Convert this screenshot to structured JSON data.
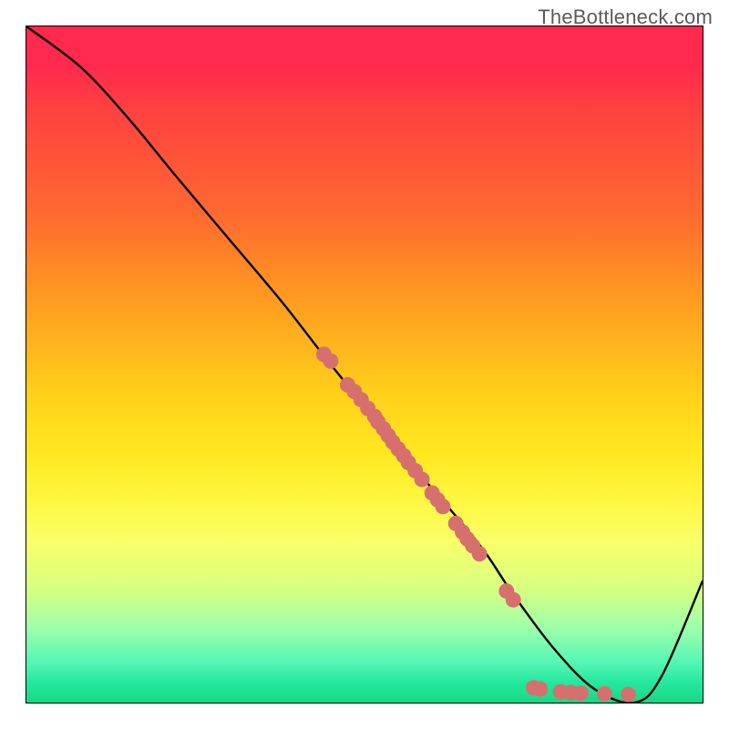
{
  "watermark": "TheBottleneck.com",
  "chart_data": {
    "type": "line",
    "title": "",
    "xlabel": "",
    "ylabel": "",
    "xlim": [
      0,
      100
    ],
    "ylim": [
      0,
      100
    ],
    "grid": false,
    "legend": false,
    "series": [
      {
        "name": "bottleneck_curve",
        "x": [
          0,
          8,
          15,
          22,
          30,
          38,
          45,
          52,
          58,
          64,
          68,
          72,
          78,
          84,
          90,
          94,
          100
        ],
        "y": [
          100,
          94,
          86.5,
          78,
          68.5,
          59,
          50,
          41.5,
          34,
          27,
          22,
          16,
          8,
          2,
          0,
          4,
          18
        ]
      }
    ],
    "scatter": {
      "name": "highlighted_points",
      "color": "#d6706e",
      "points": [
        {
          "x": 44,
          "y": 51.5
        },
        {
          "x": 45,
          "y": 50.5
        },
        {
          "x": 47.5,
          "y": 47
        },
        {
          "x": 48.5,
          "y": 46
        },
        {
          "x": 49.5,
          "y": 44.8
        },
        {
          "x": 50.5,
          "y": 43.5
        },
        {
          "x": 51.5,
          "y": 42.3
        },
        {
          "x": 52,
          "y": 41.5
        },
        {
          "x": 52.8,
          "y": 40.5
        },
        {
          "x": 53.5,
          "y": 39.5
        },
        {
          "x": 54.2,
          "y": 38.5
        },
        {
          "x": 55,
          "y": 37.5
        },
        {
          "x": 55.8,
          "y": 36.5
        },
        {
          "x": 56.5,
          "y": 35.5
        },
        {
          "x": 57.5,
          "y": 34.3
        },
        {
          "x": 58.5,
          "y": 33
        },
        {
          "x": 60,
          "y": 31
        },
        {
          "x": 60.8,
          "y": 30
        },
        {
          "x": 61.6,
          "y": 29
        },
        {
          "x": 63.5,
          "y": 26.5
        },
        {
          "x": 64.5,
          "y": 25.2
        },
        {
          "x": 65.2,
          "y": 24.2
        },
        {
          "x": 66,
          "y": 23.2
        },
        {
          "x": 67,
          "y": 22
        },
        {
          "x": 71,
          "y": 16.5
        },
        {
          "x": 72,
          "y": 15.2
        },
        {
          "x": 75,
          "y": 2.2
        },
        {
          "x": 76,
          "y": 2
        },
        {
          "x": 79,
          "y": 1.6
        },
        {
          "x": 80.5,
          "y": 1.5
        },
        {
          "x": 82,
          "y": 1.4
        },
        {
          "x": 85.5,
          "y": 1.3
        },
        {
          "x": 89,
          "y": 1.2
        }
      ]
    }
  }
}
